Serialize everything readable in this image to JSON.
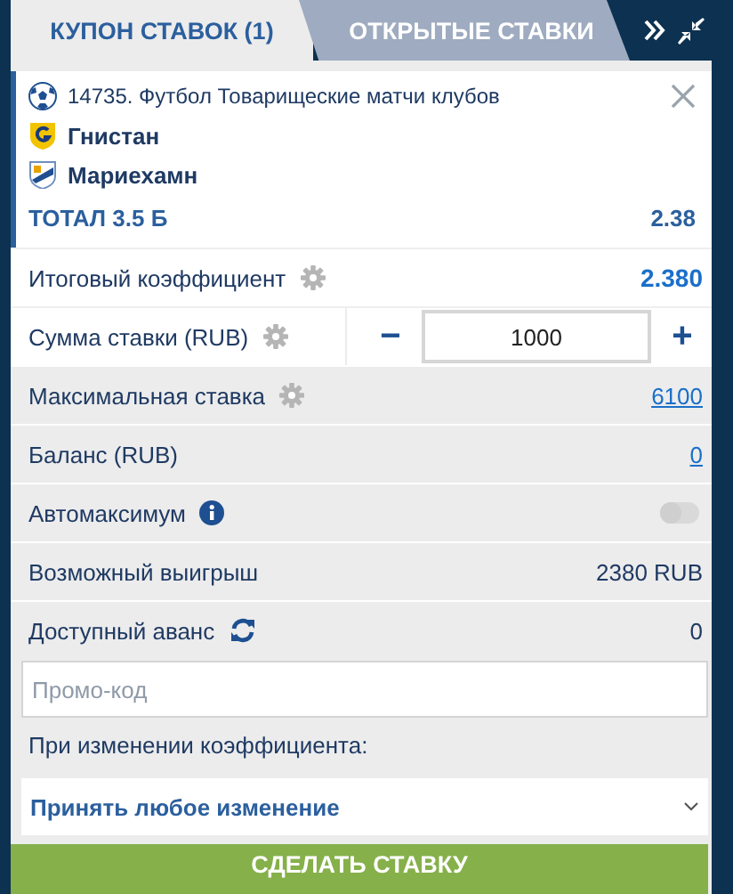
{
  "tabs": [
    {
      "label": "КУПОН СТАВОК (1)",
      "selected": true
    },
    {
      "label": "ОТКРЫТЫЕ СТАВКИ",
      "selected": false
    }
  ],
  "bet": {
    "event": "14735. Футбол Товарищеские матчи клубов",
    "teams": [
      "Гнистан",
      "Мариехамн"
    ],
    "market": "ТОТАЛ 3.5 Б",
    "odds": "2.38"
  },
  "rows": [
    {
      "kind": "odds",
      "label": "Итоговый коэффициент",
      "value": "2.380"
    },
    {
      "kind": "stepper",
      "label": "Сумма ставки (RUB)",
      "minus": "−",
      "value": "1000",
      "plus": "+"
    },
    {
      "kind": "link",
      "label": "Максимальная ставка",
      "value": "6100"
    },
    {
      "kind": "link",
      "label": "Баланс (RUB)",
      "value": "0"
    },
    {
      "kind": "toggle",
      "label": "Автомаксимум",
      "on": false
    },
    {
      "kind": "text",
      "label": "Возможный выигрыш",
      "value": "2380 RUB"
    },
    {
      "kind": "text",
      "label": "Доступный аванс",
      "value": "0"
    }
  ],
  "promo": {
    "placeholder": "Промо-код"
  },
  "odds_change": {
    "label": "При изменении коэффициента:",
    "selected_option": "Принять любое изменение"
  },
  "submit": "СДЕЛАТЬ СТАВКУ"
}
